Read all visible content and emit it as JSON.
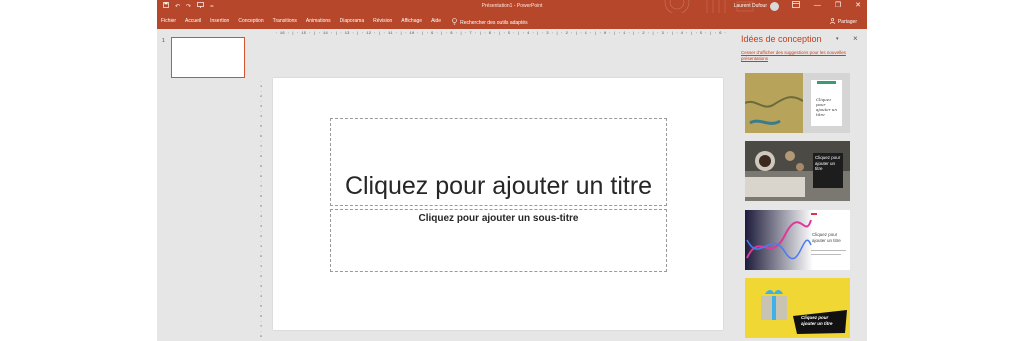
{
  "app": {
    "title": "Présentation1  -  PowerPoint",
    "user": "Laurent Dufour",
    "quick_access": [
      "save-icon",
      "undo-icon",
      "redo-icon",
      "present-icon",
      "customize-icon"
    ],
    "window_buttons": [
      "ribbon-options-icon",
      "minimize-icon",
      "restore-icon",
      "close-icon"
    ],
    "accent": "#b7472a"
  },
  "ribbon": {
    "tabs": [
      "Fichier",
      "Accueil",
      "Insertion",
      "Conception",
      "Transitions",
      "Animations",
      "Diaporama",
      "Révision",
      "Affichage",
      "Aide"
    ],
    "tell_me": "Rechercher des outils adaptés",
    "share": "Partager"
  },
  "thumbnails": {
    "slide_number": "1"
  },
  "ruler": {
    "horizontal": "· 16 · | · 15 · | · 14 · | · 13 · | · 12 · | · 11 · | · 10 · | · 9 · | · 8 · | · 7 · | · 6 · | · 5 · | · 4 · | · 3 · | · 2 · | · 1 · | · 0 · | · 1 · | · 2 · | · 3 · | · 4 · | · 5 · | · 6 · | · 7 · | · 8 · | · 9 · | · 10 · | · 11 · | · 12 · | · 13 · | · 14 · | · 15 · | · 16 ·"
  },
  "slide": {
    "title_placeholder": "Cliquez pour ajouter un titre",
    "subtitle_placeholder": "Cliquez pour ajouter un sous-titre"
  },
  "design_pane": {
    "title": "Idées de conception",
    "link": "Cesser d'afficher des suggestions pour les nouvelles présentations",
    "ideas": [
      {
        "text": "Cliquez pour ajouter un titre"
      },
      {
        "text": "Cliquez pour ajouter un titre"
      },
      {
        "text": "Cliquez pour ajouter un titre"
      },
      {
        "text": "Cliquez pour ajouter un titre"
      }
    ]
  }
}
